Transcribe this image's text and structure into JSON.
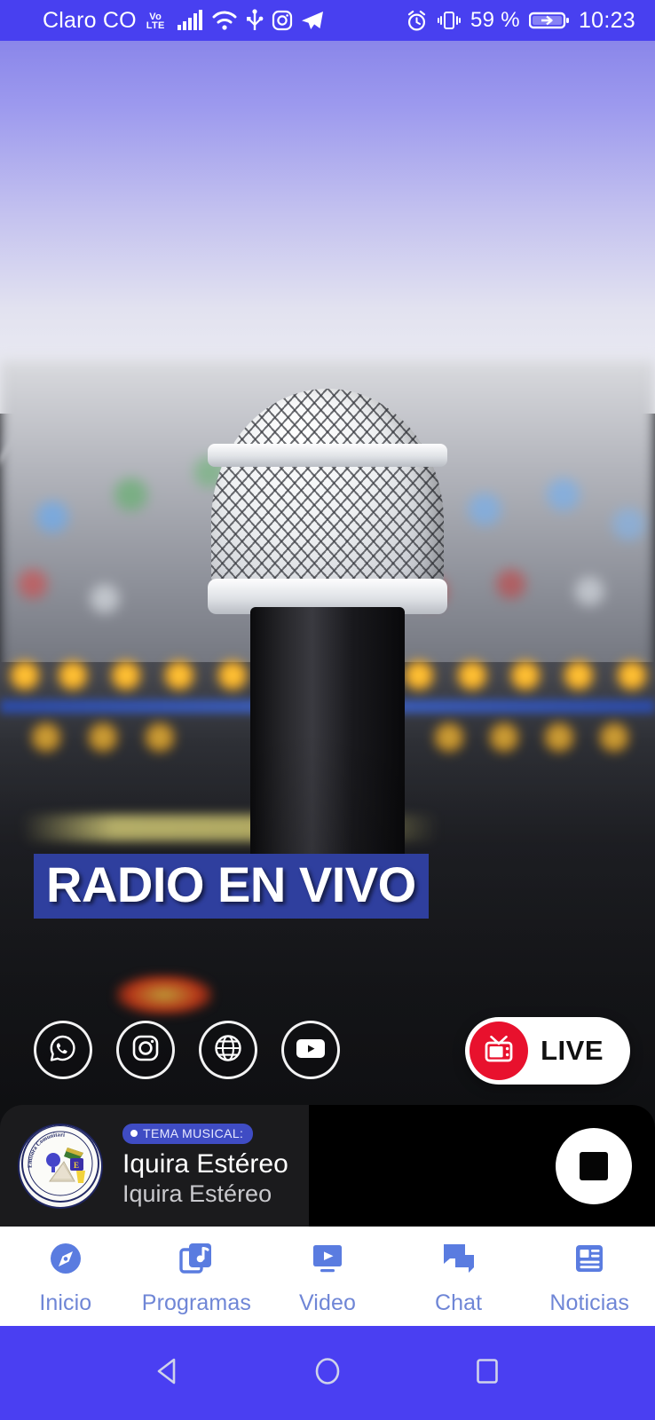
{
  "status_bar": {
    "carrier": "Claro CO",
    "network_badge_top": "Vo",
    "network_badge_bottom": "LTE",
    "icons": [
      "signal-bars-icon",
      "wifi-icon",
      "usb-icon",
      "instagram-icon",
      "telegram-icon",
      "alarm-icon",
      "vibrate-icon"
    ],
    "battery_percent": "59 %",
    "clock": "10:23",
    "background_color": "#4840F0"
  },
  "hero": {
    "title": "RADIO EN VIVO",
    "title_band_color": "#2f3f9e",
    "social_buttons": [
      {
        "name": "whatsapp",
        "icon": "whatsapp-icon"
      },
      {
        "name": "instagram",
        "icon": "instagram-icon"
      },
      {
        "name": "website",
        "icon": "globe-icon"
      },
      {
        "name": "youtube",
        "icon": "youtube-icon"
      }
    ],
    "live_button": {
      "label": "LIVE",
      "icon": "tv-icon",
      "accent_color": "#e8112d",
      "background_color": "#ffffff"
    }
  },
  "player": {
    "badge_label": "TEMA MUSICAL:",
    "badge_color": "#3f4cc4",
    "station_title": "Iquira Estéreo",
    "station_subtitle": "Iquira Estéreo",
    "logo_icon": "station-logo-icon",
    "transport_button": {
      "state": "stop",
      "icon": "stop-icon"
    }
  },
  "bottom_nav": {
    "accent_color": "#5a7ce0",
    "items": [
      {
        "label": "Inicio",
        "icon": "compass-icon"
      },
      {
        "label": "Programas",
        "icon": "music-library-icon"
      },
      {
        "label": "Video",
        "icon": "video-play-icon"
      },
      {
        "label": "Chat",
        "icon": "chat-bubbles-icon"
      },
      {
        "label": "Noticias",
        "icon": "news-article-icon"
      }
    ]
  },
  "system_nav": {
    "background_color": "#4A3FF2",
    "buttons": [
      {
        "name": "back",
        "icon": "triangle-back-icon"
      },
      {
        "name": "home",
        "icon": "circle-home-icon"
      },
      {
        "name": "recents",
        "icon": "square-recents-icon"
      }
    ]
  }
}
